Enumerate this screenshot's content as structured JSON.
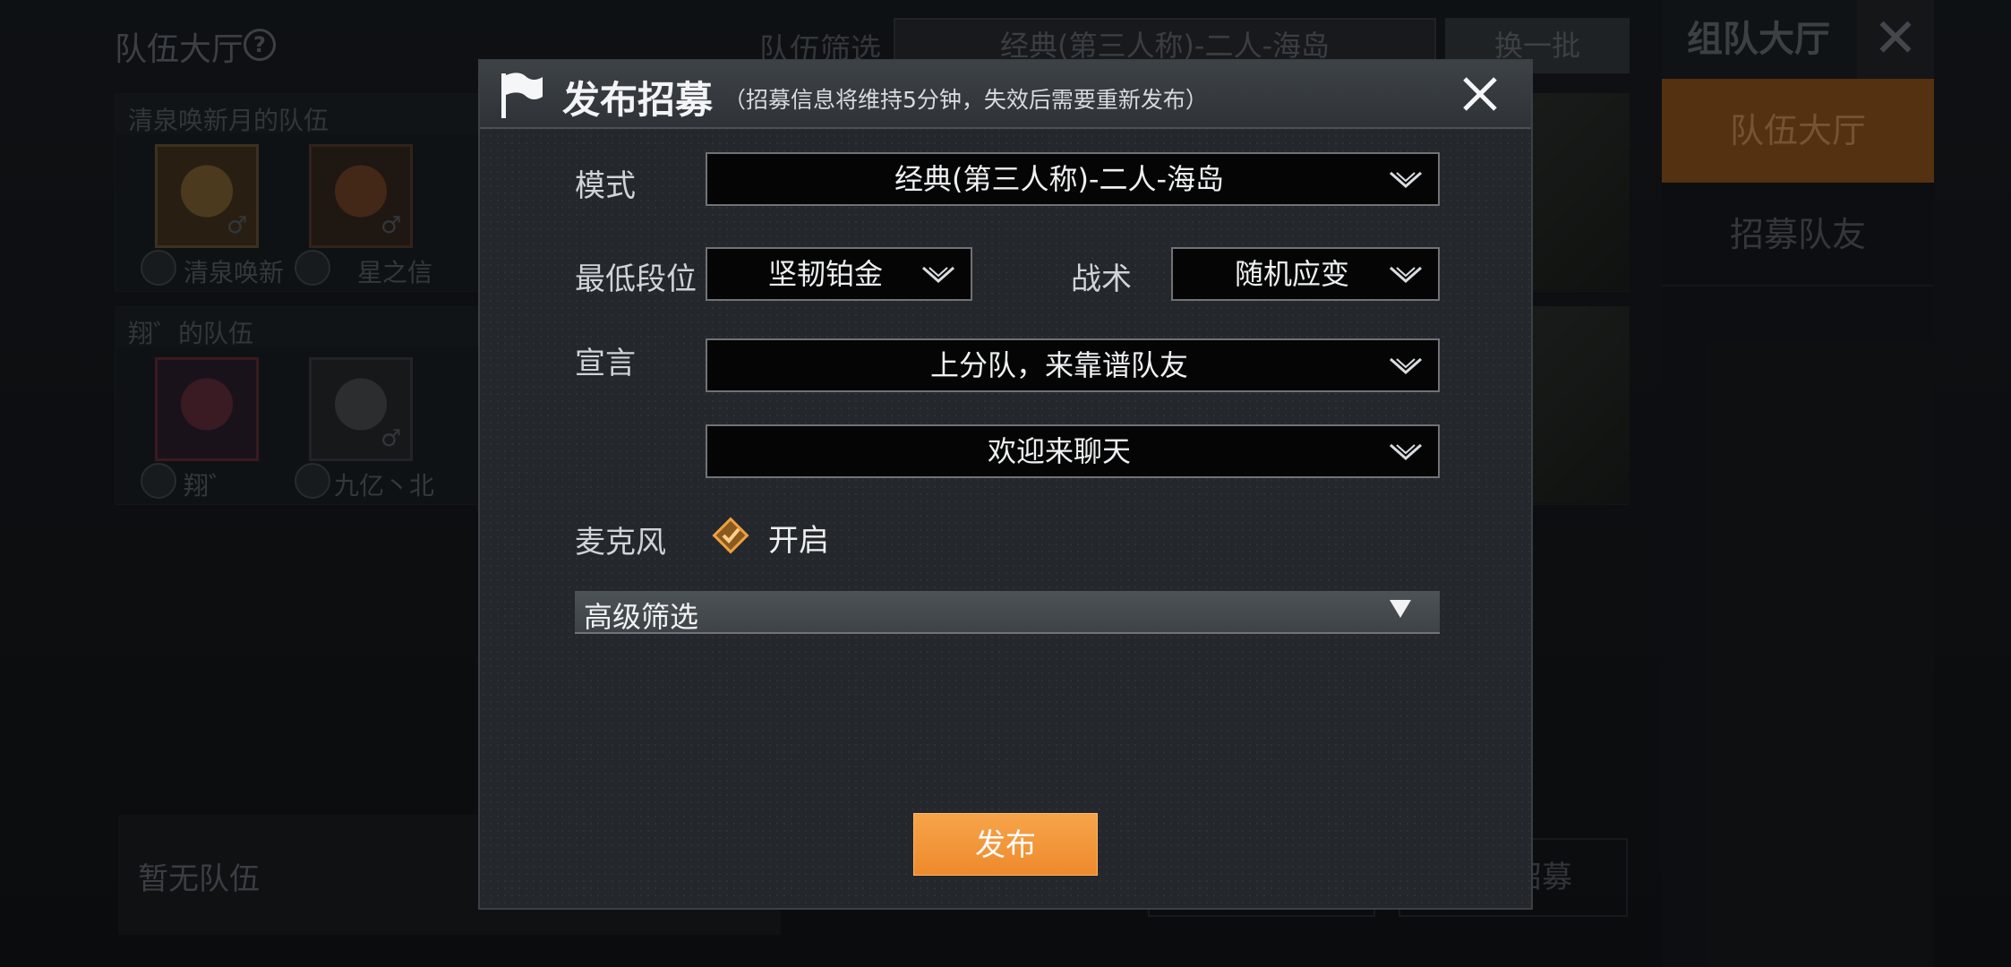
{
  "background": {
    "lobby_title": "队伍大厅",
    "help_icon": "?",
    "filter_label": "队伍筛选",
    "filter_value": "经典(第三人称)-二人-海岛",
    "refresh_button": "换一批",
    "teams": [
      {
        "name": "清泉唤新月的队伍",
        "members": [
          "清泉唤新",
          "星之信"
        ]
      },
      {
        "name": "翔゛的队伍",
        "members": [
          "翔゛",
          "九亿丶北"
        ]
      }
    ],
    "no_team_text": "暂无队伍",
    "bottom_button_text": "招募",
    "right_panel": {
      "title": "组队大厅",
      "close_glyph": "✕",
      "tabs": [
        "队伍大厅",
        "招募队友"
      ]
    }
  },
  "modal": {
    "title": "发布招募",
    "subtitle": "（招募信息将维持5分钟，失效后需要重新发布）",
    "mode_label": "模式",
    "mode_value": "经典(第三人称)-二人-海岛",
    "min_rank_label": "最低段位",
    "min_rank_value": "坚韧铂金",
    "tactic_label": "战术",
    "tactic_value": "随机应变",
    "manifesto_label": "宣言",
    "manifesto_value1": "上分队，来靠谱队友",
    "manifesto_value2": "欢迎来聊天",
    "mic_label": "麦克风",
    "mic_value": "开启",
    "mic_checked": true,
    "advanced_filter_label": "高级筛选",
    "publish_button": "发布"
  },
  "colors": {
    "accent_orange": "#f09333",
    "modal_bg": "#24282c",
    "dropdown_bg": "#050505"
  },
  "icons": {
    "header": "flag-icon",
    "close": "close-icon",
    "dropdown": "chevron-down-icon",
    "mic_check": "checkbox-checked-icon",
    "advanced": "triangle-down-icon"
  }
}
